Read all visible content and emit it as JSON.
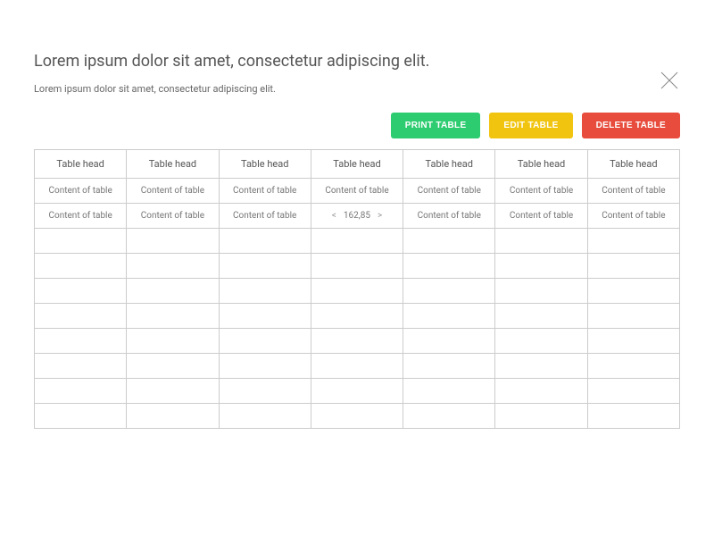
{
  "header": {
    "title": "Lorem ipsum dolor sit amet, consectetur adipiscing elit.",
    "subtitle": "Lorem ipsum dolor sit amet, consectetur adipiscing elit."
  },
  "toolbar": {
    "print_label": "PRINT TABLE",
    "edit_label": "EDIT TABLE",
    "delete_label": "DELETE TABLE"
  },
  "table": {
    "columns": [
      "Table head",
      "Table head",
      "Table head",
      "Table head",
      "Table head",
      "Table head",
      "Table head"
    ],
    "rows": [
      [
        "Content of table",
        "Content of table",
        "Content of table",
        "Content of table",
        "Content of table",
        "Content of table",
        "Content of table"
      ],
      [
        "Content of table",
        "Content of table",
        "Content of table",
        {
          "type": "stepper",
          "prev": "<",
          "value": "162,85",
          "next": ">"
        },
        "Content of table",
        "Content of table",
        "Content of table"
      ],
      [
        "",
        "",
        "",
        "",
        "",
        "",
        ""
      ],
      [
        "",
        "",
        "",
        "",
        "",
        "",
        ""
      ],
      [
        "",
        "",
        "",
        "",
        "",
        "",
        ""
      ],
      [
        "",
        "",
        "",
        "",
        "",
        "",
        ""
      ],
      [
        "",
        "",
        "",
        "",
        "",
        "",
        ""
      ],
      [
        "",
        "",
        "",
        "",
        "",
        "",
        ""
      ],
      [
        "",
        "",
        "",
        "",
        "",
        "",
        ""
      ],
      [
        "",
        "",
        "",
        "",
        "",
        "",
        ""
      ]
    ]
  }
}
